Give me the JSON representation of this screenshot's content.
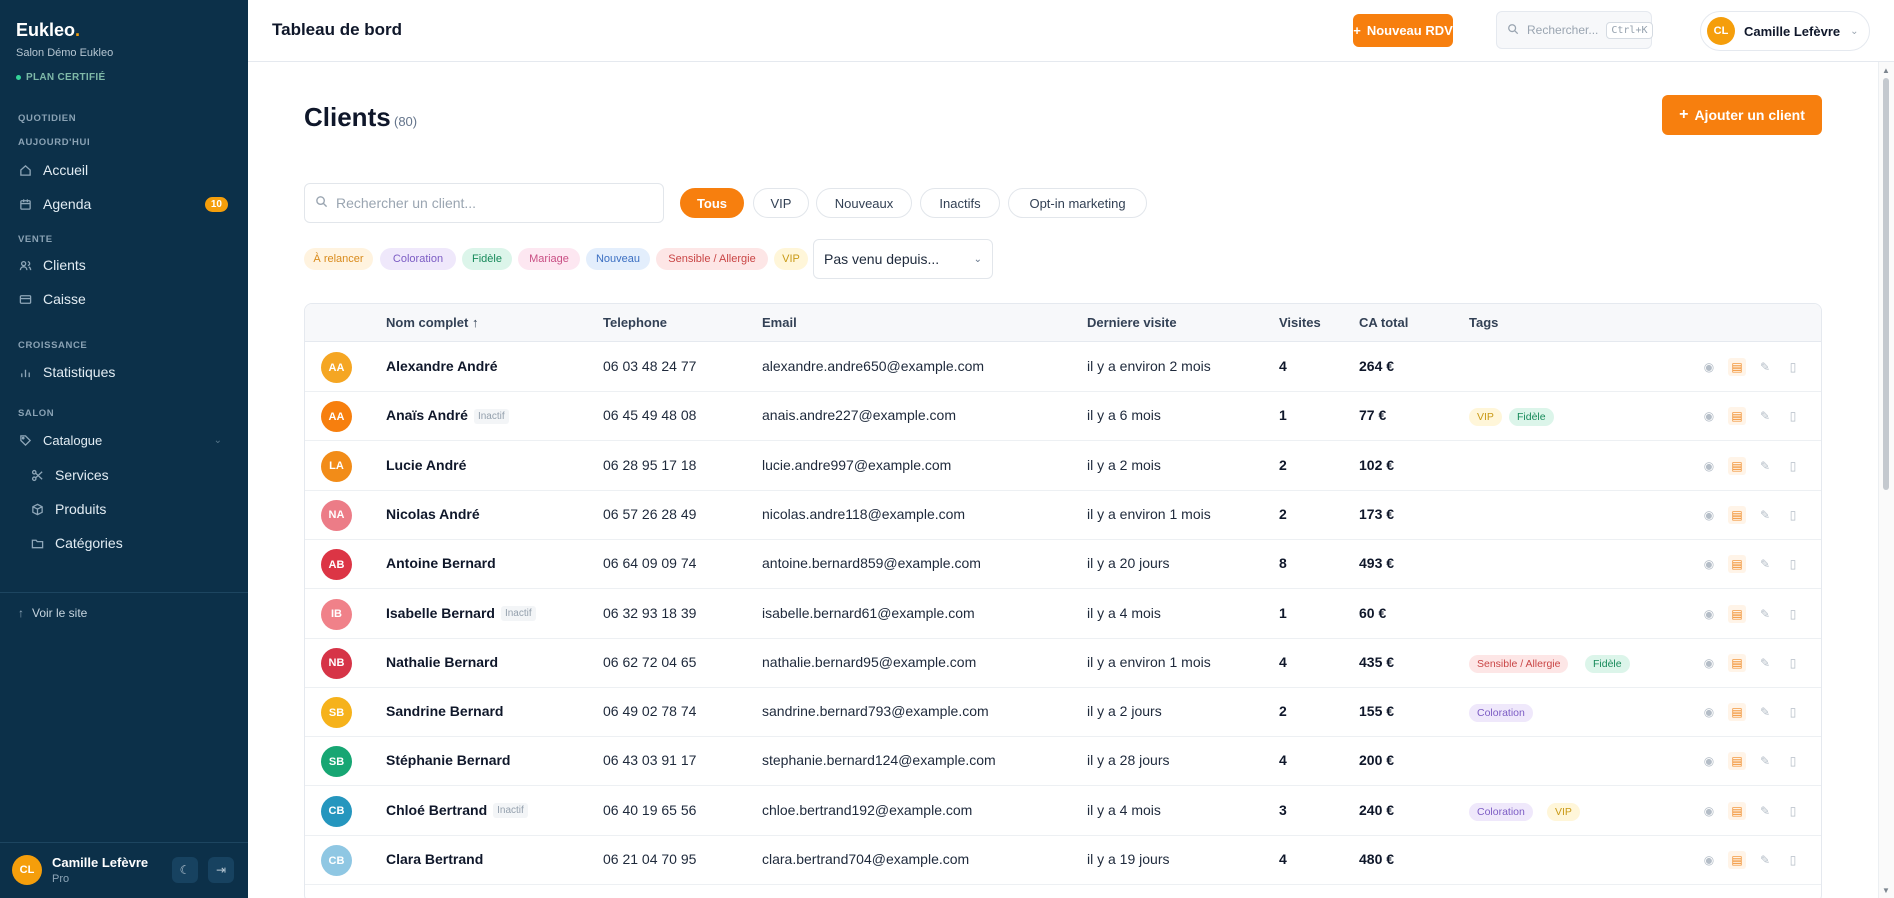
{
  "sidebar": {
    "brand": "Eukleo",
    "brand_dot": ".",
    "salon": "Salon Démo Eukleo",
    "plan": "PLAN CERTIFIÉ",
    "sections": {
      "quotidien": "QUOTIDIEN",
      "aujourdhui": "AUJOURD'HUI",
      "vente": "VENTE",
      "croissance": "CROISSANCE",
      "salon": "SALON"
    },
    "items": {
      "accueil": "Accueil",
      "agenda": "Agenda",
      "agenda_badge": "10",
      "clients": "Clients",
      "caisse": "Caisse",
      "statistiques": "Statistiques",
      "catalogue": "Catalogue",
      "services": "Services",
      "produits": "Produits",
      "categories": "Catégories"
    },
    "voir_site": "Voir le site",
    "user": {
      "initials": "CL",
      "name": "Camille Lefèvre",
      "role": "Pro"
    }
  },
  "header": {
    "title": "Tableau de bord",
    "new_rdv": "Nouveau RDV",
    "search_placeholder": "Rechercher...",
    "search_kbd": "Ctrl+K",
    "user_initials": "CL",
    "user_name": "Camille Lefèvre"
  },
  "main": {
    "title": "Clients",
    "count": "(80)",
    "add_client": "Ajouter un client",
    "search_placeholder": "Rechercher un client...",
    "filters": [
      "Tous",
      "VIP",
      "Nouveaux",
      "Inactifs",
      "Opt-in marketing"
    ],
    "tag_filters": [
      "À relancer",
      "Coloration",
      "Fidèle",
      "Mariage",
      "Nouveau",
      "Sensible / Allergie",
      "VIP"
    ],
    "select_value": "Pas venu depuis..."
  },
  "table": {
    "headers": {
      "name": "Nom complet ↑",
      "phone": "Telephone",
      "email": "Email",
      "last": "Derniere visite",
      "visits": "Visites",
      "ca": "CA total",
      "tags": "Tags"
    },
    "inactive_label": "Inactif",
    "rows": [
      {
        "initials": "AA",
        "name": "Alexandre André",
        "phone": "06 03 48 24 77",
        "email": "alexandre.andre650@example.com",
        "last": "il y a environ 2 mois",
        "visits": "4",
        "ca": "264 €",
        "tags": []
      },
      {
        "initials": "AA",
        "name": "Anaïs André",
        "phone": "06 45 49 48 08",
        "email": "anais.andre227@example.com",
        "last": "il y a 6 mois",
        "visits": "1",
        "ca": "77 €",
        "tags": [
          "VIP",
          "Fidèle"
        ]
      },
      {
        "initials": "LA",
        "name": "Lucie André",
        "phone": "06 28 95 17 18",
        "email": "lucie.andre997@example.com",
        "last": "il y a 2 mois",
        "visits": "2",
        "ca": "102 €",
        "tags": []
      },
      {
        "initials": "NA",
        "name": "Nicolas André",
        "phone": "06 57 26 28 49",
        "email": "nicolas.andre118@example.com",
        "last": "il y a environ 1 mois",
        "visits": "2",
        "ca": "173 €",
        "tags": []
      },
      {
        "initials": "AB",
        "name": "Antoine Bernard",
        "phone": "06 64 09 09 74",
        "email": "antoine.bernard859@example.com",
        "last": "il y a 20 jours",
        "visits": "8",
        "ca": "493 €",
        "tags": []
      },
      {
        "initials": "IB",
        "name": "Isabelle Bernard",
        "phone": "06 32 93 18 39",
        "email": "isabelle.bernard61@example.com",
        "last": "il y a 4 mois",
        "visits": "1",
        "ca": "60 €",
        "tags": []
      },
      {
        "initials": "NB",
        "name": "Nathalie Bernard",
        "phone": "06 62 72 04 65",
        "email": "nathalie.bernard95@example.com",
        "last": "il y a environ 1 mois",
        "visits": "4",
        "ca": "435 €",
        "tags": [
          "Sensible / Allergie",
          "Fidèle"
        ]
      },
      {
        "initials": "SB",
        "name": "Sandrine Bernard",
        "phone": "06 49 02 78 74",
        "email": "sandrine.bernard793@example.com",
        "last": "il y a 2 jours",
        "visits": "2",
        "ca": "155 €",
        "tags": [
          "Coloration"
        ]
      },
      {
        "initials": "SB",
        "name": "Stéphanie Bernard",
        "phone": "06 43 03 91 17",
        "email": "stephanie.bernard124@example.com",
        "last": "il y a 28 jours",
        "visits": "4",
        "ca": "200 €",
        "tags": []
      },
      {
        "initials": "CB",
        "name": "Chloé Bertrand",
        "phone": "06 40 19 65 56",
        "email": "chloe.bertrand192@example.com",
        "last": "il y a 4 mois",
        "visits": "3",
        "ca": "240 €",
        "tags": [
          "Coloration",
          "VIP"
        ]
      },
      {
        "initials": "CB",
        "name": "Clara Bertrand",
        "phone": "06 21 04 70 95",
        "email": "clara.bertrand704@example.com",
        "last": "il y a 19 jours",
        "visits": "4",
        "ca": "480 €",
        "tags": []
      }
    ]
  },
  "colors": {
    "accent": "#f77f0e",
    "sidebar": "#0c3049"
  }
}
